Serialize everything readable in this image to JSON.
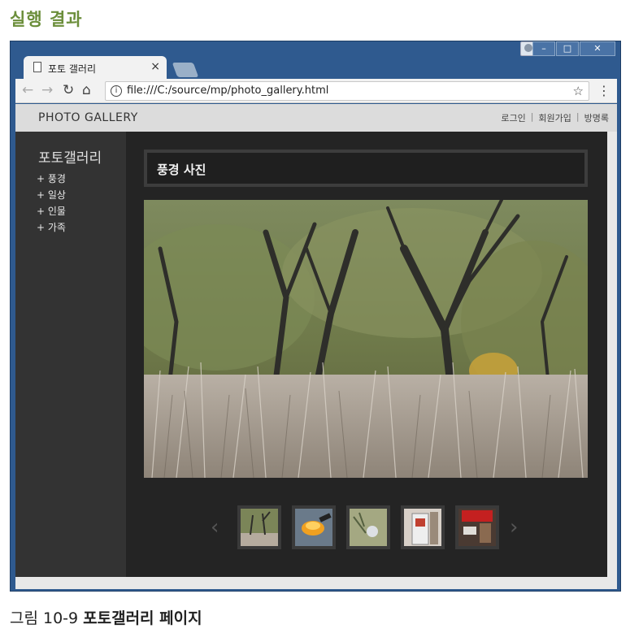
{
  "heading": "실행 결과",
  "caption": {
    "number": "그림 10-9",
    "text": "포토갤러리 페이지"
  },
  "browser": {
    "tab_title": "포토 갤러리",
    "tab_close": "×",
    "url": "file:///C:/source/mp/photo_gallery.html",
    "window_controls": {
      "minimize": "–",
      "maximize": "□",
      "close": "✕"
    }
  },
  "app": {
    "brand": "PHOTO GALLERY",
    "top_links": [
      "로그인",
      "회원가입",
      "방명록"
    ],
    "sidebar": {
      "title": "포토갤러리",
      "items": [
        "+ 풍경",
        "+ 일상",
        "+ 인물",
        "+ 가족"
      ]
    },
    "gallery_title": "풍경 사진",
    "thumbnails": [
      "thumbnail-trees",
      "thumbnail-lamp",
      "thumbnail-bird",
      "thumbnail-door",
      "thumbnail-red"
    ]
  }
}
